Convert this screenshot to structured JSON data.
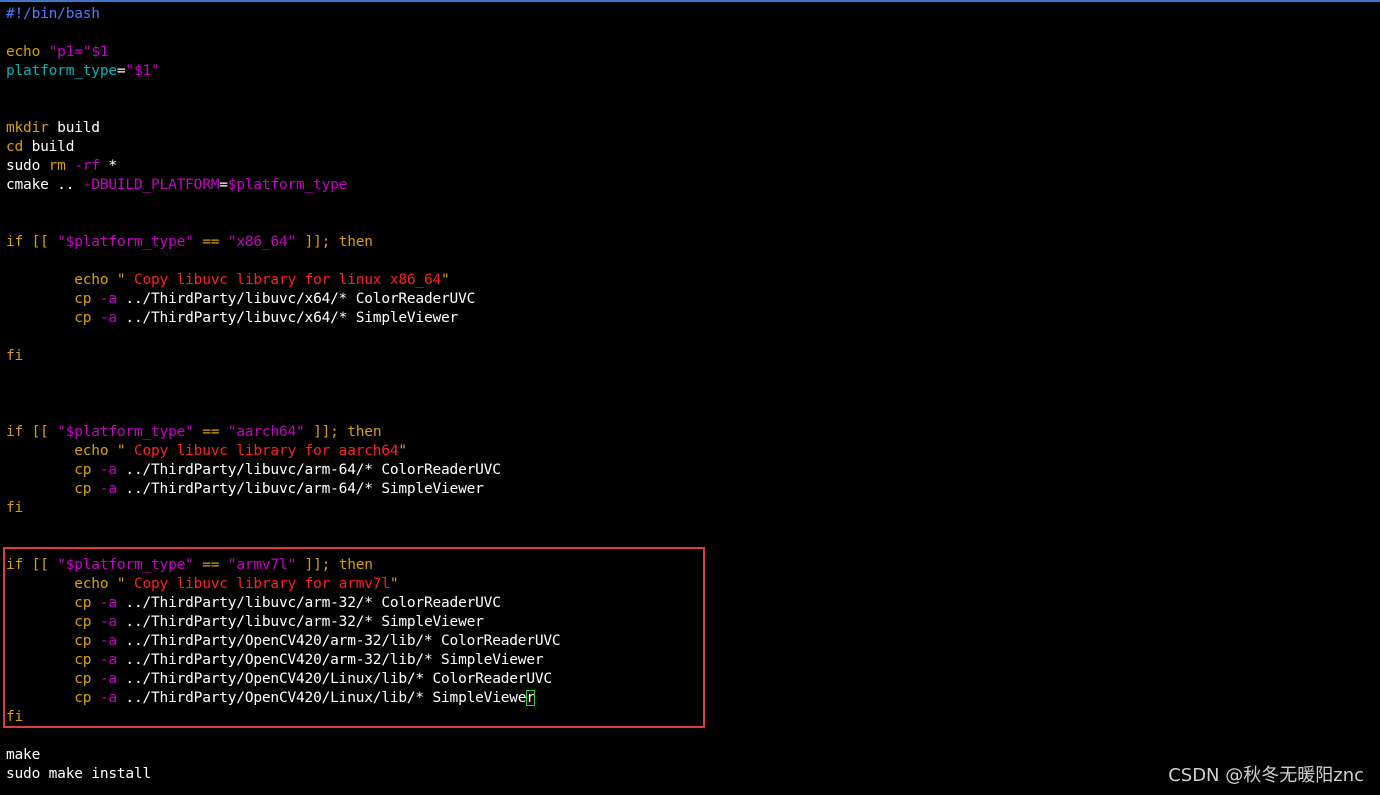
{
  "theme": {
    "background": "#000000",
    "default_text": "#ffffff",
    "keyword_color": "#d7a000",
    "string_color": "#c800c8",
    "echo_string_color": "#ff2020",
    "variable_color": "#00b4b4",
    "shebang_color": "#4a7cff",
    "highlight_box_color": "#e23a3a",
    "cursor_color": "#31d131"
  },
  "file": {
    "lines": [
      [
        {
          "t": "#!/bin/bash",
          "c": "#4a7cff"
        }
      ],
      [],
      [
        {
          "t": "echo ",
          "c": "#d7a000"
        },
        {
          "t": "\"p1=\"",
          "c": "#c800c8"
        },
        {
          "t": "$1",
          "c": "#c800c8"
        }
      ],
      [
        {
          "t": "platform_type",
          "c": "#00b4b4"
        },
        {
          "t": "=",
          "c": "#ffffff"
        },
        {
          "t": "\"$1\"",
          "c": "#c800c8"
        }
      ],
      [],
      [],
      [
        {
          "t": "mkdir",
          "c": "#d7a000"
        },
        {
          "t": " build",
          "c": "#ffffff"
        }
      ],
      [
        {
          "t": "cd",
          "c": "#d7a000"
        },
        {
          "t": " build",
          "c": "#ffffff"
        }
      ],
      [
        {
          "t": "sudo ",
          "c": "#ffffff"
        },
        {
          "t": "rm",
          "c": "#d7a000"
        },
        {
          "t": " ",
          "c": "#ffffff"
        },
        {
          "t": "-rf",
          "c": "#c800c8"
        },
        {
          "t": " *",
          "c": "#ffffff"
        }
      ],
      [
        {
          "t": "cmake .. ",
          "c": "#ffffff"
        },
        {
          "t": "-DBUILD_PLATFORM",
          "c": "#c800c8"
        },
        {
          "t": "=",
          "c": "#ffffff"
        },
        {
          "t": "$platform_type",
          "c": "#c800c8"
        }
      ],
      [],
      [],
      [
        {
          "t": "if",
          "c": "#d7a000"
        },
        {
          "t": " [[ ",
          "c": "#d7a000"
        },
        {
          "t": "\"",
          "c": "#c800c8"
        },
        {
          "t": "$platform_type",
          "c": "#c800c8"
        },
        {
          "t": "\"",
          "c": "#c800c8"
        },
        {
          "t": " == ",
          "c": "#d7a000"
        },
        {
          "t": "\"x86_64\"",
          "c": "#c800c8"
        },
        {
          "t": " ]]; then",
          "c": "#d7a000"
        }
      ],
      [],
      [
        {
          "t": "        echo ",
          "c": "#d7a000"
        },
        {
          "t": "\" ",
          "c": "#d7a000"
        },
        {
          "t": "Copy libuvc library for linux x86_64",
          "c": "#ff2020"
        },
        {
          "t": "\"",
          "c": "#d7a000"
        }
      ],
      [
        {
          "t": "        cp ",
          "c": "#d7a000"
        },
        {
          "t": "-a",
          "c": "#c800c8"
        },
        {
          "t": " ../ThirdParty/libuvc/x64/* ColorReaderUVC",
          "c": "#ffffff"
        }
      ],
      [
        {
          "t": "        cp ",
          "c": "#d7a000"
        },
        {
          "t": "-a",
          "c": "#c800c8"
        },
        {
          "t": " ../ThirdParty/libuvc/x64/* SimpleViewer",
          "c": "#ffffff"
        }
      ],
      [],
      [
        {
          "t": "fi",
          "c": "#d7a000"
        }
      ],
      [],
      [],
      [],
      [
        {
          "t": "if",
          "c": "#d7a000"
        },
        {
          "t": " [[ ",
          "c": "#d7a000"
        },
        {
          "t": "\"",
          "c": "#c800c8"
        },
        {
          "t": "$platform_type",
          "c": "#c800c8"
        },
        {
          "t": "\"",
          "c": "#c800c8"
        },
        {
          "t": " == ",
          "c": "#d7a000"
        },
        {
          "t": "\"aarch64\"",
          "c": "#c800c8"
        },
        {
          "t": " ]]; then",
          "c": "#d7a000"
        }
      ],
      [
        {
          "t": "        echo ",
          "c": "#d7a000"
        },
        {
          "t": "\" ",
          "c": "#d7a000"
        },
        {
          "t": "Copy libuvc library for aarch64",
          "c": "#ff2020"
        },
        {
          "t": "\"",
          "c": "#d7a000"
        }
      ],
      [
        {
          "t": "        cp ",
          "c": "#d7a000"
        },
        {
          "t": "-a",
          "c": "#c800c8"
        },
        {
          "t": " ../ThirdParty/libuvc/arm-64/* ColorReaderUVC",
          "c": "#ffffff"
        }
      ],
      [
        {
          "t": "        cp ",
          "c": "#d7a000"
        },
        {
          "t": "-a",
          "c": "#c800c8"
        },
        {
          "t": " ../ThirdParty/libuvc/arm-64/* SimpleViewer",
          "c": "#ffffff"
        }
      ],
      [
        {
          "t": "fi",
          "c": "#d7a000"
        }
      ],
      [],
      [],
      [
        {
          "t": "if",
          "c": "#d7a000"
        },
        {
          "t": " [[ ",
          "c": "#d7a000"
        },
        {
          "t": "\"",
          "c": "#c800c8"
        },
        {
          "t": "$platform_type",
          "c": "#c800c8"
        },
        {
          "t": "\"",
          "c": "#c800c8"
        },
        {
          "t": " == ",
          "c": "#d7a000"
        },
        {
          "t": "\"armv7l\"",
          "c": "#c800c8"
        },
        {
          "t": " ]]; then",
          "c": "#d7a000"
        }
      ],
      [
        {
          "t": "        echo ",
          "c": "#d7a000"
        },
        {
          "t": "\" ",
          "c": "#d7a000"
        },
        {
          "t": "Copy libuvc library for armv7l",
          "c": "#ff2020"
        },
        {
          "t": "\"",
          "c": "#d7a000"
        }
      ],
      [
        {
          "t": "        cp ",
          "c": "#d7a000"
        },
        {
          "t": "-a",
          "c": "#c800c8"
        },
        {
          "t": " ../ThirdParty/libuvc/arm-32/* ColorReaderUVC",
          "c": "#ffffff"
        }
      ],
      [
        {
          "t": "        cp ",
          "c": "#d7a000"
        },
        {
          "t": "-a",
          "c": "#c800c8"
        },
        {
          "t": " ../ThirdParty/libuvc/arm-32/* SimpleViewer",
          "c": "#ffffff"
        }
      ],
      [
        {
          "t": "        cp ",
          "c": "#d7a000"
        },
        {
          "t": "-a",
          "c": "#c800c8"
        },
        {
          "t": " ../ThirdParty/OpenCV420/arm-32/lib/* ColorReaderUVC",
          "c": "#ffffff"
        }
      ],
      [
        {
          "t": "        cp ",
          "c": "#d7a000"
        },
        {
          "t": "-a",
          "c": "#c800c8"
        },
        {
          "t": " ../ThirdParty/OpenCV420/arm-32/lib/* SimpleViewer",
          "c": "#ffffff"
        }
      ],
      [
        {
          "t": "        cp ",
          "c": "#d7a000"
        },
        {
          "t": "-a",
          "c": "#c800c8"
        },
        {
          "t": " ../ThirdParty/OpenCV420/Linux/lib/* ColorReaderUVC",
          "c": "#ffffff"
        }
      ],
      [
        {
          "t": "        cp ",
          "c": "#d7a000"
        },
        {
          "t": "-a",
          "c": "#c800c8"
        },
        {
          "t": " ../ThirdParty/OpenCV420/Linux/lib/* SimpleViewe",
          "c": "#ffffff"
        },
        {
          "t": "r",
          "c": "#ffffff",
          "cursor": true
        }
      ],
      [
        {
          "t": "fi",
          "c": "#d7a000"
        }
      ],
      [],
      [
        {
          "t": "make",
          "c": "#ffffff"
        }
      ],
      [
        {
          "t": "sudo make install",
          "c": "#ffffff"
        }
      ]
    ]
  },
  "watermark": {
    "text": "CSDN @秋冬无暖阳znc"
  }
}
